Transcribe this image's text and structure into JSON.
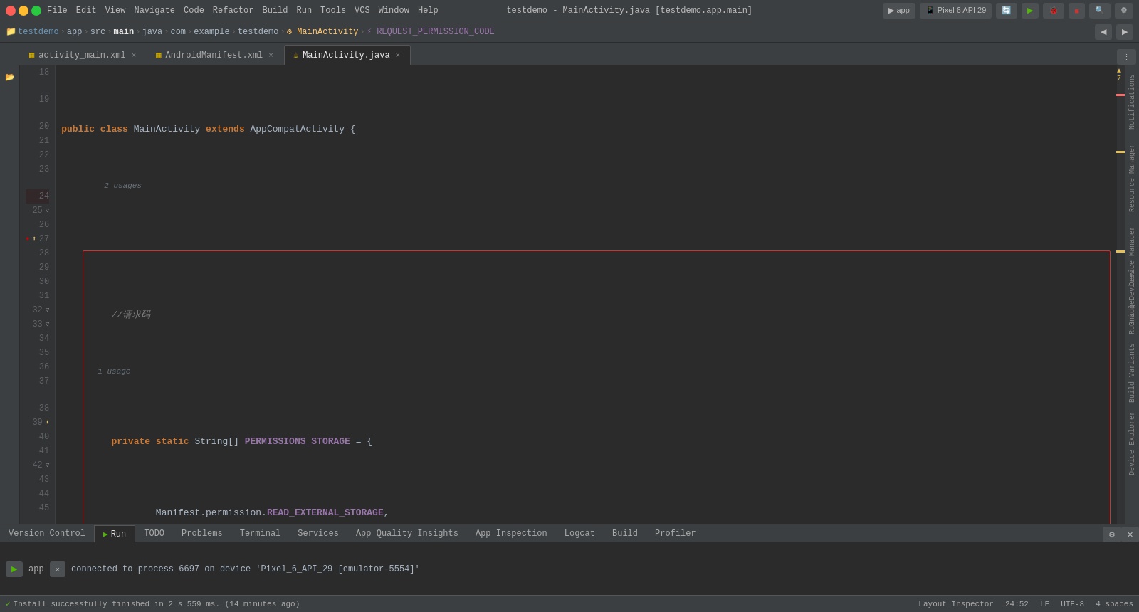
{
  "titleBar": {
    "title": "testdemo - MainActivity.java [testdemo.app.main]",
    "menus": [
      "File",
      "Edit",
      "View",
      "Navigate",
      "Code",
      "Refactor",
      "Build",
      "Run",
      "Tools",
      "VCS",
      "Window",
      "Help"
    ]
  },
  "breadcrumb": {
    "items": [
      "testdemo",
      "app",
      "src",
      "main",
      "java",
      "com",
      "example",
      "testdemo",
      "MainActivity"
    ],
    "symbol": "REQUEST_PERMISSION_CODE"
  },
  "tabs": [
    {
      "label": "activity_main.xml",
      "icon": "xml",
      "active": false
    },
    {
      "label": "AndroidManifest.xml",
      "icon": "xml",
      "active": false
    },
    {
      "label": "MainActivity.java",
      "icon": "java",
      "active": true
    }
  ],
  "deviceSelector": "Pixel 6 API 29",
  "runApp": "app",
  "warningCount": "▲ 7",
  "bottomTabs": [
    {
      "label": "Version Control",
      "active": false
    },
    {
      "label": "Run",
      "icon": "run",
      "active": true
    },
    {
      "label": "TODO",
      "active": false
    },
    {
      "label": "Problems",
      "active": false
    },
    {
      "label": "Terminal",
      "active": false
    },
    {
      "label": "Services",
      "active": false
    },
    {
      "label": "App Quality Insights",
      "active": false
    },
    {
      "label": "App Inspection",
      "active": false
    },
    {
      "label": "Logcat",
      "active": false
    },
    {
      "label": "Build",
      "active": false
    },
    {
      "label": "Profiler",
      "active": false
    }
  ],
  "consoleOutput": "connected to process 6697 on device 'Pixel_6_API_29 [emulator-5554]'",
  "runTarget": "app",
  "statusBar": {
    "message": "Install successfully finished in 2 s 559 ms. (14 minutes ago)",
    "position": "24:52",
    "lineEnding": "LF",
    "encoding": "UTF-8",
    "indent": "4 spaces",
    "inspectorLabel": "Layout Inspector"
  },
  "sidebarLabels": {
    "notifications": "Notifications",
    "resourceManager": "Resource Manager",
    "deviceManager": "Device Manager",
    "gradle": "Gradle",
    "runningDevices": "Running Devices",
    "deviceExplorer": "Device Explorer",
    "buildVariants": "Build Variants"
  }
}
